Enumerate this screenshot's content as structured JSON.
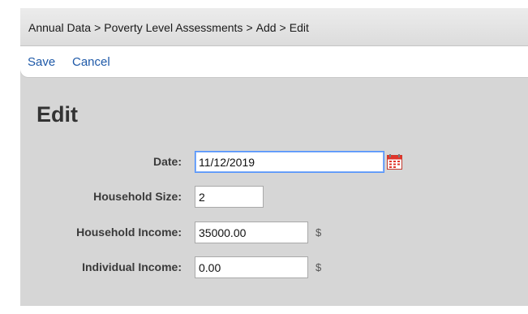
{
  "breadcrumb": {
    "items": [
      "Annual Data",
      "Poverty Level Assessments",
      "Add",
      "Edit"
    ],
    "separator": ">"
  },
  "actions": {
    "save_label": "Save",
    "cancel_label": "Cancel"
  },
  "page": {
    "title": "Edit"
  },
  "form": {
    "date": {
      "label": "Date:",
      "value": "11/12/2019",
      "icon": "calendar-icon"
    },
    "household_size": {
      "label": "Household Size:",
      "value": "2"
    },
    "household_income": {
      "label": "Household Income:",
      "value": "35000.00",
      "unit": "$"
    },
    "individual_income": {
      "label": "Individual Income:",
      "value": "0.00",
      "unit": "$"
    }
  },
  "colors": {
    "link": "#1e59a8",
    "background": "#d6d6d6",
    "calendar_accent": "#e0352b"
  }
}
